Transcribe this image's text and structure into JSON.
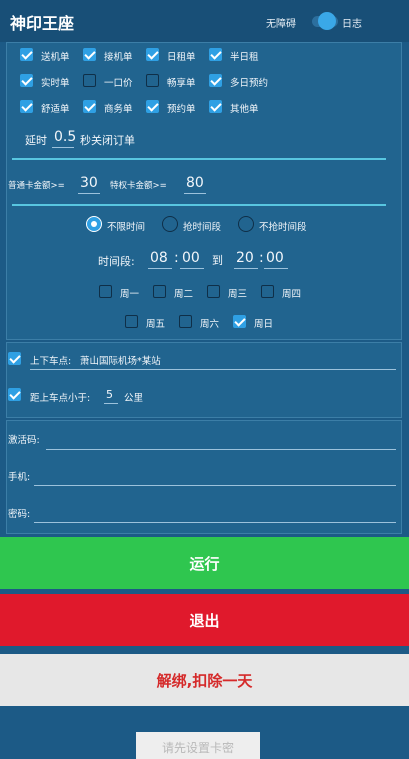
{
  "header": {
    "title": "神印王座",
    "accessibility_label": "无障碍",
    "log_label": "日志"
  },
  "order_types": {
    "items": [
      {
        "label": "送机单",
        "checked": true
      },
      {
        "label": "接机单",
        "checked": true
      },
      {
        "label": "日租单",
        "checked": true
      },
      {
        "label": "半日租",
        "checked": true
      },
      {
        "label": "实时单",
        "checked": true
      },
      {
        "label": "一口价",
        "checked": false
      },
      {
        "label": "畅享单",
        "checked": false
      },
      {
        "label": "多日预约",
        "checked": true
      },
      {
        "label": "舒适单",
        "checked": true
      },
      {
        "label": "商务单",
        "checked": true
      },
      {
        "label": "预约单",
        "checked": true
      },
      {
        "label": "其他单",
        "checked": true
      }
    ]
  },
  "delay": {
    "prefix": "延时",
    "value": "0.5",
    "suffix": "秒关闭订单"
  },
  "amounts": {
    "normal_label": "普通卡金额>=",
    "normal_value": "30",
    "special_label": "特权卡金额>=",
    "special_value": "80"
  },
  "time_mode": {
    "options": [
      {
        "label": "不限时间",
        "selected": true
      },
      {
        "label": "抢时间段",
        "selected": false
      },
      {
        "label": "不抢时间段",
        "selected": false
      }
    ]
  },
  "time_range": {
    "label": "时间段:",
    "start_hour": "08",
    "start_min": "00",
    "separator": "到",
    "end_hour": "20",
    "end_min": "00",
    "colon": ":"
  },
  "weekdays": {
    "items": [
      {
        "label": "周一",
        "checked": false
      },
      {
        "label": "周二",
        "checked": false
      },
      {
        "label": "周三",
        "checked": false
      },
      {
        "label": "周四",
        "checked": false
      },
      {
        "label": "周五",
        "checked": false
      },
      {
        "label": "周六",
        "checked": false
      },
      {
        "label": "周日",
        "checked": true
      }
    ]
  },
  "pickup": {
    "label": "上下车点:",
    "value": "萧山国际机场*某站",
    "checked": true
  },
  "distance": {
    "label": "距上车点小于:",
    "value": "5",
    "unit": "公里",
    "checked": true
  },
  "account": {
    "activation_label": "激活码:",
    "activation_value": "",
    "phone_label": "手机:",
    "phone_value": "",
    "password_label": "密码:",
    "password_value": ""
  },
  "buttons": {
    "run": "运行",
    "exit": "退出",
    "unbind": "解绑,扣除一天"
  },
  "hint": {
    "text": "请先设置卡密"
  },
  "colors": {
    "background": "#1c5a86",
    "panel": "#21648f",
    "accent": "#2fa0e4",
    "run": "#2fc64f",
    "exit": "#e0192c",
    "unbind_bg": "#e7e7e7",
    "unbind_text": "#d52a2a"
  }
}
